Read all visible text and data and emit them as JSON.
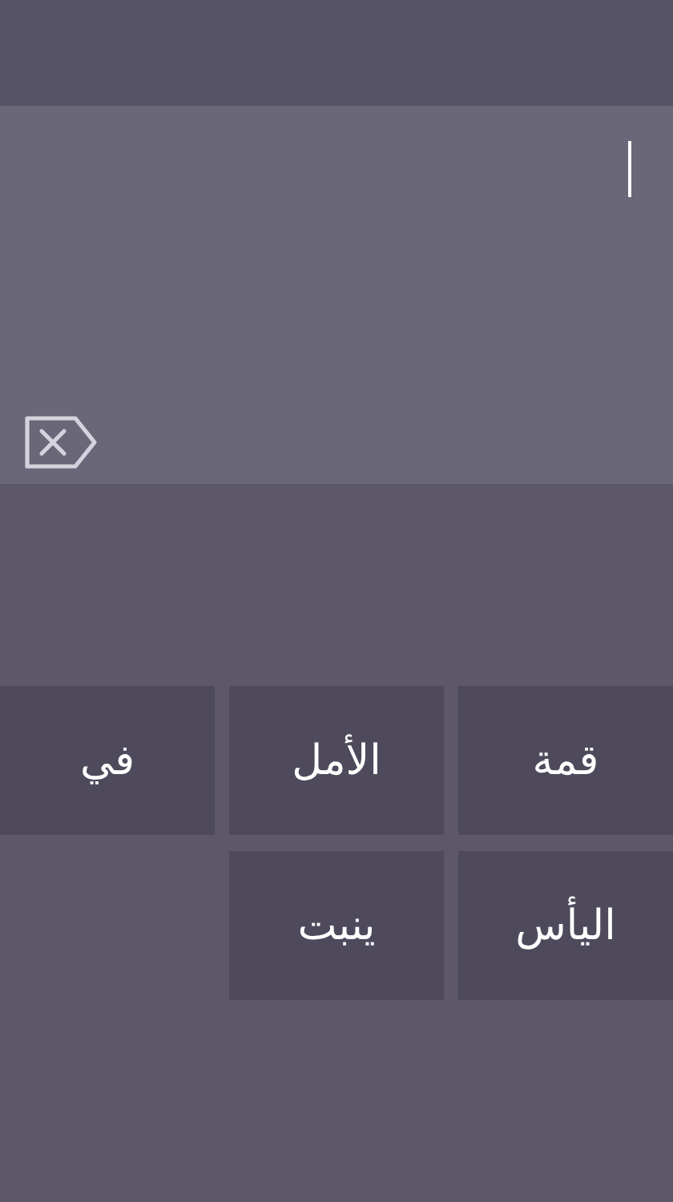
{
  "word_tiles": [
    {
      "label": "قمة"
    },
    {
      "label": "الأمل"
    },
    {
      "label": "في"
    },
    {
      "label": "اليأس"
    },
    {
      "label": "ينبت"
    }
  ]
}
